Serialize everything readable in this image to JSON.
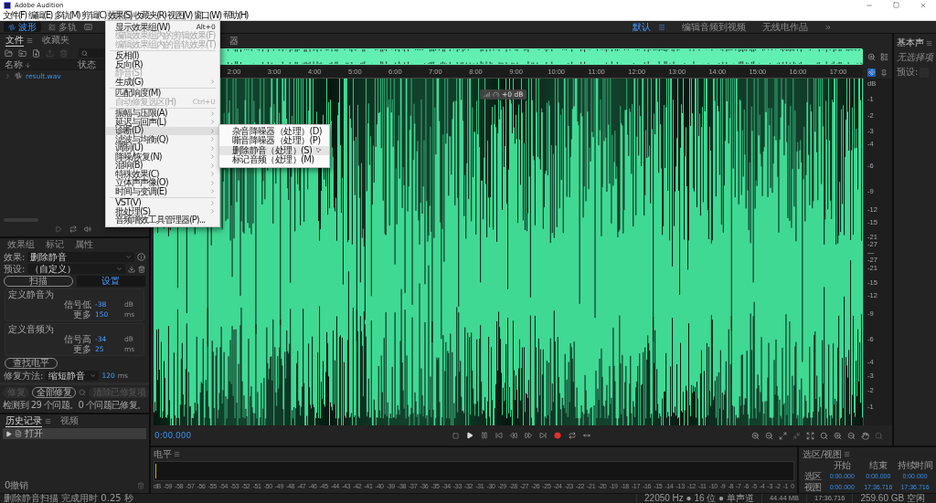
{
  "window": {
    "title": "Adobe Audition"
  },
  "menu_bar": [
    {
      "label": "文件(F)",
      "selected": false
    },
    {
      "label": "编辑(E)",
      "selected": false
    },
    {
      "label": "多轨(M)",
      "selected": false
    },
    {
      "label": "剪辑(C)",
      "selected": false
    },
    {
      "label": "效果(S)",
      "selected": true
    },
    {
      "label": "收藏夹(R)",
      "selected": false
    },
    {
      "label": "视图(V)",
      "selected": false
    },
    {
      "label": "窗口(W)",
      "selected": false
    },
    {
      "label": "帮助(H)",
      "selected": false
    }
  ],
  "effects_menu": {
    "items": [
      {
        "kind": "item",
        "label": "显示效果组(W)",
        "shortcut": "Alt+0",
        "disabled": false,
        "submenu": false,
        "selected": false
      },
      {
        "kind": "item",
        "label": "编辑效果组内的剪辑效果(F)",
        "disabled": true,
        "submenu": false,
        "selected": false
      },
      {
        "kind": "item",
        "label": "编辑效果组内的音轨效果(T)",
        "disabled": true,
        "submenu": false,
        "selected": false
      },
      {
        "kind": "separator"
      },
      {
        "kind": "item",
        "label": "反相(I)",
        "disabled": false,
        "submenu": false,
        "selected": false
      },
      {
        "kind": "item",
        "label": "反向(R)",
        "disabled": false,
        "submenu": false,
        "selected": false
      },
      {
        "kind": "item",
        "label": "静音(S)",
        "disabled": true,
        "submenu": false,
        "selected": false
      },
      {
        "kind": "item",
        "label": "生成(G)",
        "disabled": false,
        "submenu": true,
        "selected": false
      },
      {
        "kind": "separator"
      },
      {
        "kind": "item",
        "label": "匹配响度(M)",
        "disabled": false,
        "submenu": false,
        "selected": false
      },
      {
        "kind": "item",
        "label": "自动修复选区(H)",
        "shortcut": "Ctrl+U",
        "disabled": true,
        "submenu": false,
        "selected": false
      },
      {
        "kind": "separator"
      },
      {
        "kind": "item",
        "label": "振幅与压限(A)",
        "disabled": false,
        "submenu": true,
        "selected": false
      },
      {
        "kind": "item",
        "label": "延迟与回声(L)",
        "disabled": false,
        "submenu": true,
        "selected": false
      },
      {
        "kind": "item",
        "label": "诊断(D)",
        "disabled": false,
        "submenu": true,
        "selected": true
      },
      {
        "kind": "item",
        "label": "滤波与均衡(Q)",
        "disabled": false,
        "submenu": true,
        "selected": false
      },
      {
        "kind": "item",
        "label": "调制(U)",
        "disabled": false,
        "submenu": true,
        "selected": false
      },
      {
        "kind": "item",
        "label": "降噪/恢复(N)",
        "disabled": false,
        "submenu": true,
        "selected": false
      },
      {
        "kind": "item",
        "label": "混响(B)",
        "disabled": false,
        "submenu": true,
        "selected": false
      },
      {
        "kind": "item",
        "label": "特殊效果(C)",
        "disabled": false,
        "submenu": true,
        "selected": false
      },
      {
        "kind": "item",
        "label": "立体声声像(O)",
        "disabled": false,
        "submenu": true,
        "selected": false
      },
      {
        "kind": "item",
        "label": "时间与变调(E)",
        "disabled": false,
        "submenu": true,
        "selected": false
      },
      {
        "kind": "separator"
      },
      {
        "kind": "item",
        "label": "VST(V)",
        "disabled": false,
        "submenu": true,
        "selected": false
      },
      {
        "kind": "item",
        "label": "批处理(S)",
        "disabled": false,
        "submenu": true,
        "selected": false
      },
      {
        "kind": "item",
        "label": "音频增效工具管理器(P)...",
        "disabled": false,
        "submenu": false,
        "selected": false
      }
    ],
    "submenu": [
      {
        "label": "杂音降噪器（处理）(D)",
        "selected": false
      },
      {
        "label": "嘶音降噪器（处理）(P)",
        "selected": false
      },
      {
        "label": "删除静音（处理）(S)",
        "selected": true
      },
      {
        "label": "标记音频（处理）(M)",
        "selected": false
      }
    ]
  },
  "toolbar": {
    "views": [
      {
        "label": "波形",
        "selected": true
      },
      {
        "label": "多轨",
        "selected": false
      }
    ],
    "workspaces": [
      {
        "label": "默认",
        "selected": true
      },
      {
        "label": "编辑音频到视频",
        "selected": false
      },
      {
        "label": "无线电作品",
        "selected": false
      }
    ]
  },
  "files_panel": {
    "tabs": [
      {
        "label": "文件",
        "selected": true
      },
      {
        "label": "收藏夹",
        "selected": false
      }
    ],
    "columns": [
      "名称",
      "状态"
    ],
    "files": [
      {
        "name": "result.wav",
        "expanded": false
      }
    ]
  },
  "effects_panel": {
    "tabs": [
      {
        "label": "效果组",
        "selected": false
      },
      {
        "label": "标记",
        "selected": false
      },
      {
        "label": "属性",
        "selected": false
      }
    ],
    "effect": {
      "label": "效果:",
      "value": "删除静音"
    },
    "preset": {
      "label": "预设:",
      "value": "（自定义）"
    },
    "modes": [
      {
        "label": "扫描",
        "selected": false
      },
      {
        "label": "设置",
        "selected": true
      }
    ],
    "groups": [
      {
        "title": "定义静音为",
        "rows": [
          {
            "label": "信号低",
            "value": "-38",
            "unit": "dB"
          },
          {
            "label": "更多",
            "value": "150",
            "unit": "ms"
          }
        ]
      },
      {
        "title": "定义音频为",
        "rows": [
          {
            "label": "信号高",
            "value": "-34",
            "unit": "dB"
          },
          {
            "label": "更多",
            "value": "25",
            "unit": "ms"
          }
        ]
      }
    ],
    "find_level": "查找电平",
    "repair": {
      "label": "修复方法:",
      "method": "缩短静音",
      "value": "120",
      "unit": "ms"
    },
    "actions": [
      {
        "label": "修复",
        "disabled": true
      },
      {
        "label": "全部修复",
        "disabled": false
      },
      {
        "label": "清除已修复项",
        "disabled": true
      }
    ],
    "result": "检测到 29 个问题。0 个问题已修复。"
  },
  "history_panel": {
    "tabs": [
      {
        "label": "历史记录",
        "selected": true
      },
      {
        "label": "视频",
        "selected": false
      }
    ],
    "entries": [
      {
        "label": "打开",
        "selected": true
      }
    ],
    "undo_count": "0撤销"
  },
  "editor": {
    "tab_fragment": "器",
    "ruler": [
      "2:00",
      "3:00",
      "4:00",
      "5:00",
      "6:00",
      "7:00",
      "8:00",
      "9:00",
      "10:00",
      "11:00",
      "12:00",
      "13:00",
      "14:00",
      "15:00",
      "16:00",
      "17:00"
    ],
    "hud": {
      "reading": "+0 dB"
    },
    "db_scale": [
      "dB",
      "-1",
      "-2",
      "-3",
      "-4",
      "-6",
      "-9",
      "-12",
      "-15",
      "-21",
      "-27",
      "—",
      "-27",
      "-21",
      "-15",
      "-12",
      "-9",
      "-6",
      "-4",
      "-3",
      "-2",
      "-1"
    ],
    "time": "0:00.000"
  },
  "essential_sound": {
    "title": "基本声",
    "empty_text": "无选择项",
    "preset_label": "预设:"
  },
  "level_meter": {
    "title": "电平",
    "scale": [
      "dB",
      "-59",
      "-58",
      "-57",
      "-56",
      "-55",
      "-54",
      "-53",
      "-52",
      "-51",
      "-50",
      "-49",
      "-48",
      "-47",
      "-46",
      "-45",
      "-44",
      "-43",
      "-42",
      "-41",
      "-40",
      "-39",
      "-38",
      "-37",
      "-36",
      "-35",
      "-34",
      "-33",
      "-32",
      "-31",
      "-30",
      "-29",
      "-28",
      "-27",
      "-26",
      "-25",
      "-24",
      "-23",
      "-22",
      "-21",
      "-20",
      "-19",
      "-18",
      "-17",
      "-16",
      "-15",
      "-14",
      "-13",
      "-12",
      "-11",
      "-10",
      "-9",
      "-8",
      "-7",
      "-6",
      "-5",
      "-4",
      "-3",
      "-2",
      "-1",
      "0"
    ]
  },
  "selection_view": {
    "title": "选区/视图",
    "columns": [
      "开始",
      "结束",
      "持续时间"
    ],
    "rows": [
      {
        "label": "选区",
        "values": [
          "0:00.000",
          "0:00.000",
          "0:00.000"
        ]
      },
      {
        "label": "视图",
        "values": [
          "0:00.000",
          "17:36.716",
          "17:36.716"
        ]
      }
    ]
  },
  "status_bar": {
    "message": "删除静音扫描 完成用时 0.25 秒",
    "sample_format": "22050 Hz ● 16 位 ● 单声道",
    "size": "44.44 MB",
    "duration": "17:36.716",
    "free_space": "259.60 GB 空闲"
  }
}
